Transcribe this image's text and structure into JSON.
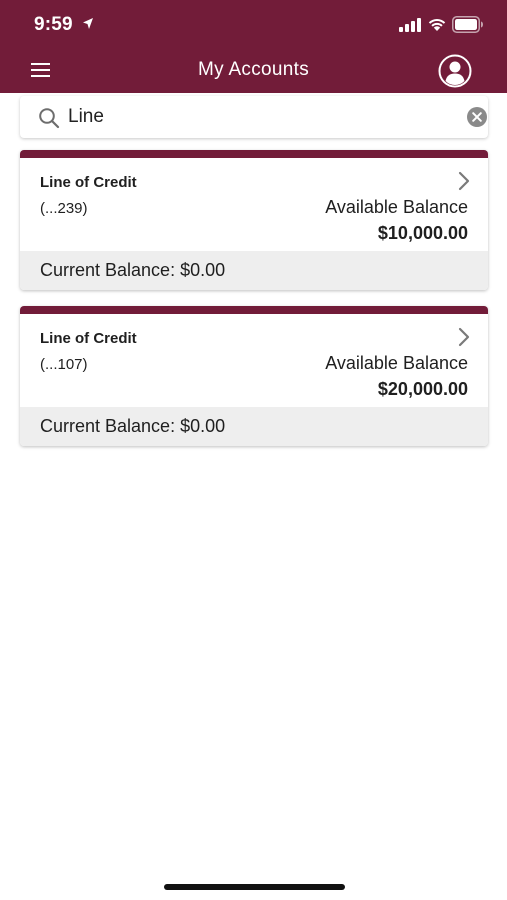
{
  "status_bar": {
    "time": "9:59"
  },
  "header": {
    "title": "My Accounts",
    "background": "#721c39"
  },
  "search": {
    "value": "Line",
    "placeholder": "Search"
  },
  "accounts": [
    {
      "name": "Line of Credit",
      "number": "(...239)",
      "available_label": "Available Balance",
      "available_value": "$10,000.00",
      "current_balance": "Current Balance: $0.00"
    },
    {
      "name": "Line of Credit",
      "number": "(...107)",
      "available_label": "Available Balance",
      "available_value": "$20,000.00",
      "current_balance": "Current Balance: $0.00"
    }
  ],
  "icons": {
    "menu": "hamburger-menu-icon",
    "profile": "user-profile-icon",
    "search": "magnifier-icon",
    "clear": "clear-x-icon",
    "chevron": "chevron-right-icon"
  }
}
